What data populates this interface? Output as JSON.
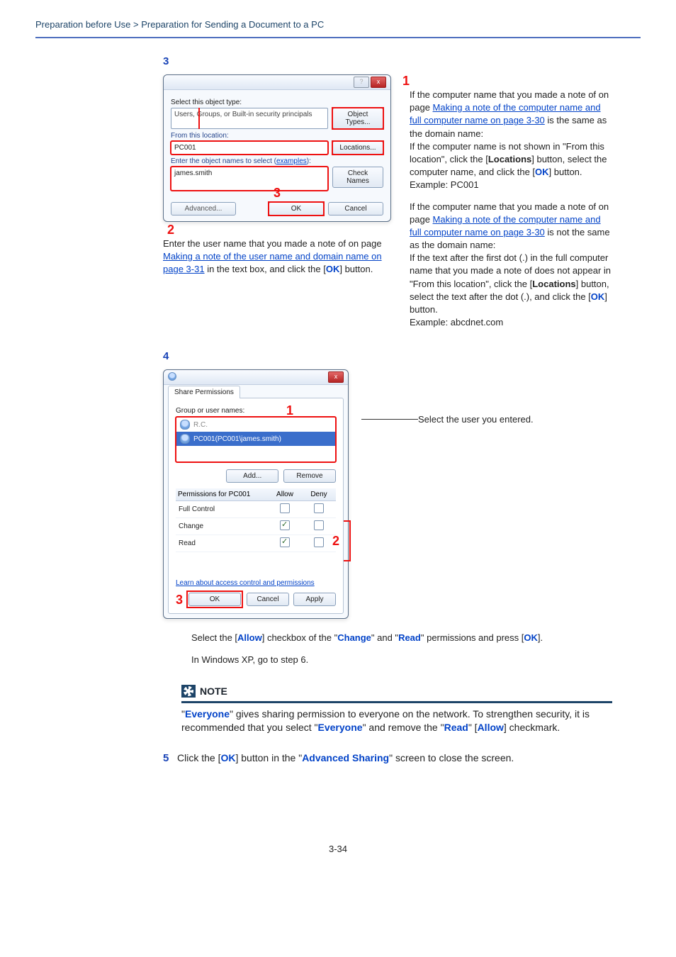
{
  "breadcrumb": "Preparation before Use > Preparation for Sending a Document to a PC",
  "step3": {
    "num": "3",
    "dlg": {
      "title": " ",
      "help_label": "?",
      "close_label": "x",
      "select_type_label": "Select this object type:",
      "object_types_value": "Users, Groups, or Built-in security principals",
      "object_types_btn": "Object Types...",
      "from_location_label": "From this location:",
      "from_location_value": "PC001",
      "locations_btn": "Locations...",
      "enter_names_label_pre": "Enter the object names to select (",
      "enter_names_examples": "examples",
      "enter_names_label_post": "):",
      "name_value": "james.smith",
      "check_names_btn": "Check Names",
      "advanced_btn": "Advanced...",
      "ok_btn": "OK",
      "cancel_btn": "Cancel"
    },
    "callouts": {
      "one": "1",
      "two": "2",
      "three": "3"
    },
    "caption_1": "Enter the user name that you made a note of on page ",
    "caption_link": "Making a note of the user name and domain name on page 3-31",
    "caption_2": " in the text box, and click the [",
    "caption_ok": "OK",
    "caption_3": "] button.",
    "rhs": {
      "p1_a": "If the computer name that you made a note of on page ",
      "p1_link": "Making a note of the computer name and full computer name on page 3-30",
      "p1_b": " is the same as the domain name:",
      "p1_c": "If the computer name is not shown in \"From this location\", click the [",
      "p1_loc": "Locations",
      "p1_d": "] button, select the computer name, and click the [",
      "p1_ok": "OK",
      "p1_e": "] button.",
      "p1_ex": "Example: PC001",
      "p2_a": "If the computer name that you made a note of on page ",
      "p2_link": "Making a note of the computer name and full computer name on page 3-30",
      "p2_b": " is not the same as the domain name:",
      "p2_c": "If the text after the first dot (.) in the full computer name that you made a note of does not appear in \"From this location\", click the [",
      "p2_loc": "Locations",
      "p2_d": "] button, select the text after the dot (.), and click the [",
      "p2_ok": "OK",
      "p2_e": "] button.",
      "p2_ex": "Example: abcdnet.com"
    }
  },
  "step4": {
    "num": "4",
    "dlg": {
      "close": "x",
      "tab": "Share Permissions",
      "group_label": "Group or user names:",
      "row1": "R.C.",
      "row2": "PC001(PC001\\james.smith)",
      "add_btn": "Add...",
      "remove_btn": "Remove",
      "perm_for": "Permissions for PC001",
      "allow": "Allow",
      "deny": "Deny",
      "full": "Full Control",
      "change": "Change",
      "read": "Read",
      "learn": "Learn about access control and permissions",
      "ok": "OK",
      "cancel": "Cancel",
      "apply": "Apply"
    },
    "callouts": {
      "one": "1",
      "two": "2",
      "three": "3"
    },
    "select_user_label": "Select the user you entered.",
    "allow_sentence_a": "Select the [",
    "allow_sentence_allow": "Allow",
    "allow_sentence_b": "] checkbox of the \"",
    "allow_sentence_change": "Change",
    "allow_sentence_c": "\" and \"",
    "allow_sentence_read": "Read",
    "allow_sentence_d": "\" permissions and press [",
    "allow_sentence_ok": "OK",
    "allow_sentence_e": "].",
    "xp_line": "In Windows XP, go to step 6."
  },
  "note": {
    "head": "NOTE",
    "a": "\"",
    "everyone1": "Everyone",
    "b": "\" gives sharing permission to everyone on the network. To strengthen security, it is recommended that you select \"",
    "everyone2": "Everyone",
    "c": "\" and remove the \"",
    "read": "Read",
    "d": "\" [",
    "allow": "Allow",
    "e": "] checkmark."
  },
  "step5": {
    "num": "5",
    "a": "Click the [",
    "ok": "OK",
    "b": "] button in the \"",
    "adv": "Advanced Sharing",
    "c": "\" screen to close the screen."
  },
  "footer": "3-34"
}
